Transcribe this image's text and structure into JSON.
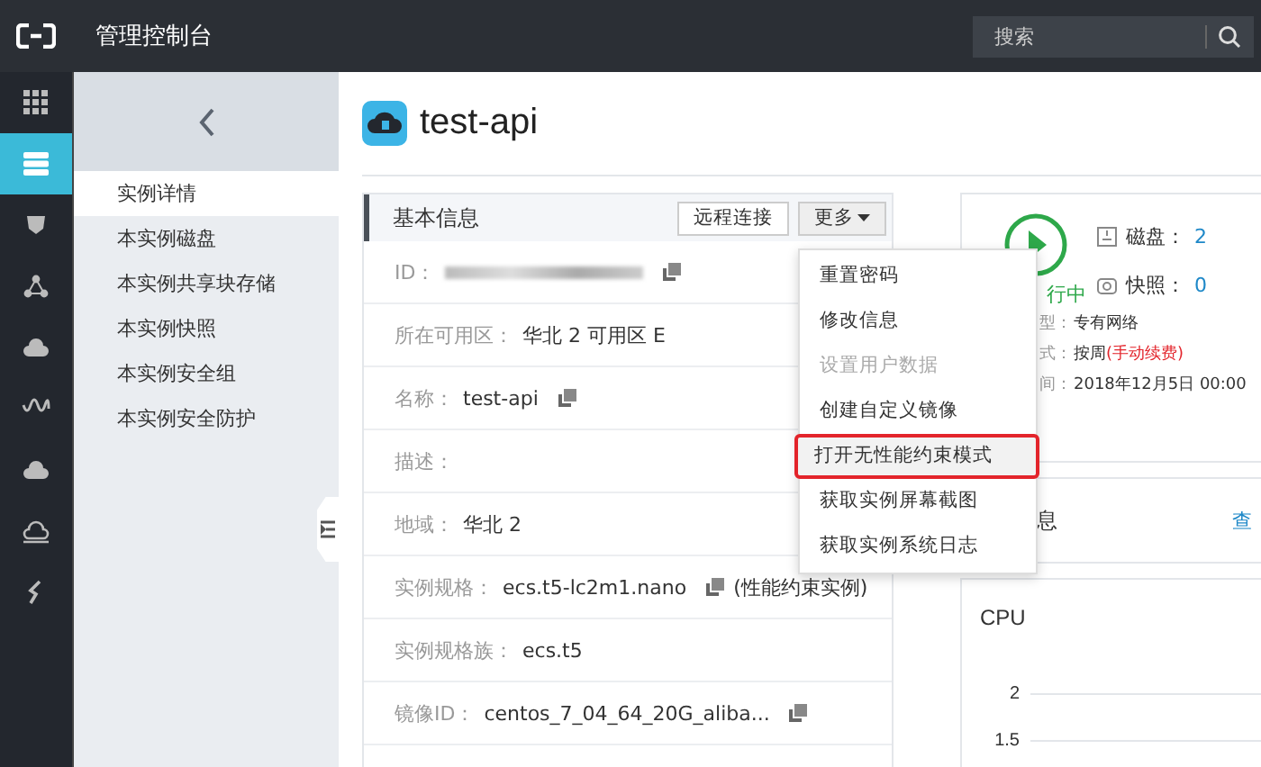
{
  "topbar": {
    "title": "管理控制台",
    "search": {
      "placeholder": "搜索"
    }
  },
  "rail": [
    {
      "kind": "grid",
      "selected": false
    },
    {
      "kind": "server",
      "selected": true
    },
    {
      "kind": "shield",
      "selected": false
    },
    {
      "kind": "nodes",
      "selected": false
    },
    {
      "kind": "cloud-up",
      "selected": false
    },
    {
      "kind": "wave",
      "selected": false
    },
    {
      "kind": "cloud",
      "selected": false
    },
    {
      "kind": "cloud-outline",
      "selected": false
    },
    {
      "kind": "link",
      "selected": false
    }
  ],
  "sidebar": {
    "items": [
      {
        "label": "实例详情",
        "selected": true
      },
      {
        "label": "本实例磁盘",
        "selected": false
      },
      {
        "label": "本实例共享块存储",
        "selected": false
      },
      {
        "label": "本实例快照",
        "selected": false
      },
      {
        "label": "本实例安全组",
        "selected": false
      },
      {
        "label": "本实例安全防护",
        "selected": false
      }
    ]
  },
  "instance": {
    "name": "test-api"
  },
  "basic_info": {
    "title": "基本信息",
    "remote_button": "远程连接",
    "more_button": "更多",
    "rows": [
      {
        "label": "ID：",
        "kind": "redacted",
        "copy": true
      },
      {
        "label": "所在可用区：",
        "value": "华北 2 可用区 E",
        "kind": "text"
      },
      {
        "label": "名称：",
        "value": "test-api",
        "kind": "text",
        "copy": true
      },
      {
        "label": "描述：",
        "kind": "text"
      },
      {
        "label": "地域：",
        "value": "华北 2",
        "kind": "text"
      },
      {
        "label": "实例规格：",
        "value": "ecs.t5-lc2m1.nano",
        "note": "(性能约束实例)",
        "kind": "text",
        "copy": true
      },
      {
        "label": "实例规格族：",
        "value": "ecs.t5",
        "kind": "text"
      },
      {
        "label": "镜像ID：",
        "value": "centos_7_04_64_20G_aliba...",
        "kind": "text",
        "copy": true
      }
    ]
  },
  "more_menu": [
    {
      "label": "重置密码",
      "disabled": false,
      "highlighted": false
    },
    {
      "label": "修改信息",
      "disabled": false,
      "highlighted": false
    },
    {
      "label": "设置用户数据",
      "disabled": true,
      "highlighted": false
    },
    {
      "label": "创建自定义镜像",
      "disabled": false,
      "highlighted": false
    },
    {
      "label": "打开无性能约束模式",
      "disabled": false,
      "highlighted": true
    },
    {
      "label": "获取实例屏幕截图",
      "disabled": false,
      "highlighted": false
    },
    {
      "label": "获取实例系统日志",
      "disabled": false,
      "highlighted": false
    }
  ],
  "status_panel": {
    "status": "行中",
    "stats": [
      {
        "kind": "disk",
        "label": "磁盘：",
        "value": "2"
      },
      {
        "kind": "snapshot",
        "label": "快照：",
        "value": "0"
      }
    ],
    "details": [
      {
        "label": "型：",
        "value": "专有网络"
      },
      {
        "label": "式：",
        "value": "按周",
        "note": "(手动续费)"
      },
      {
        "label": "间：",
        "value": "2018年12月5日 00:00"
      }
    ]
  },
  "monitor": {
    "title": "息",
    "link": "查"
  },
  "cpu": {
    "title": "CPU",
    "yticks": [
      "2",
      "1.5"
    ]
  }
}
